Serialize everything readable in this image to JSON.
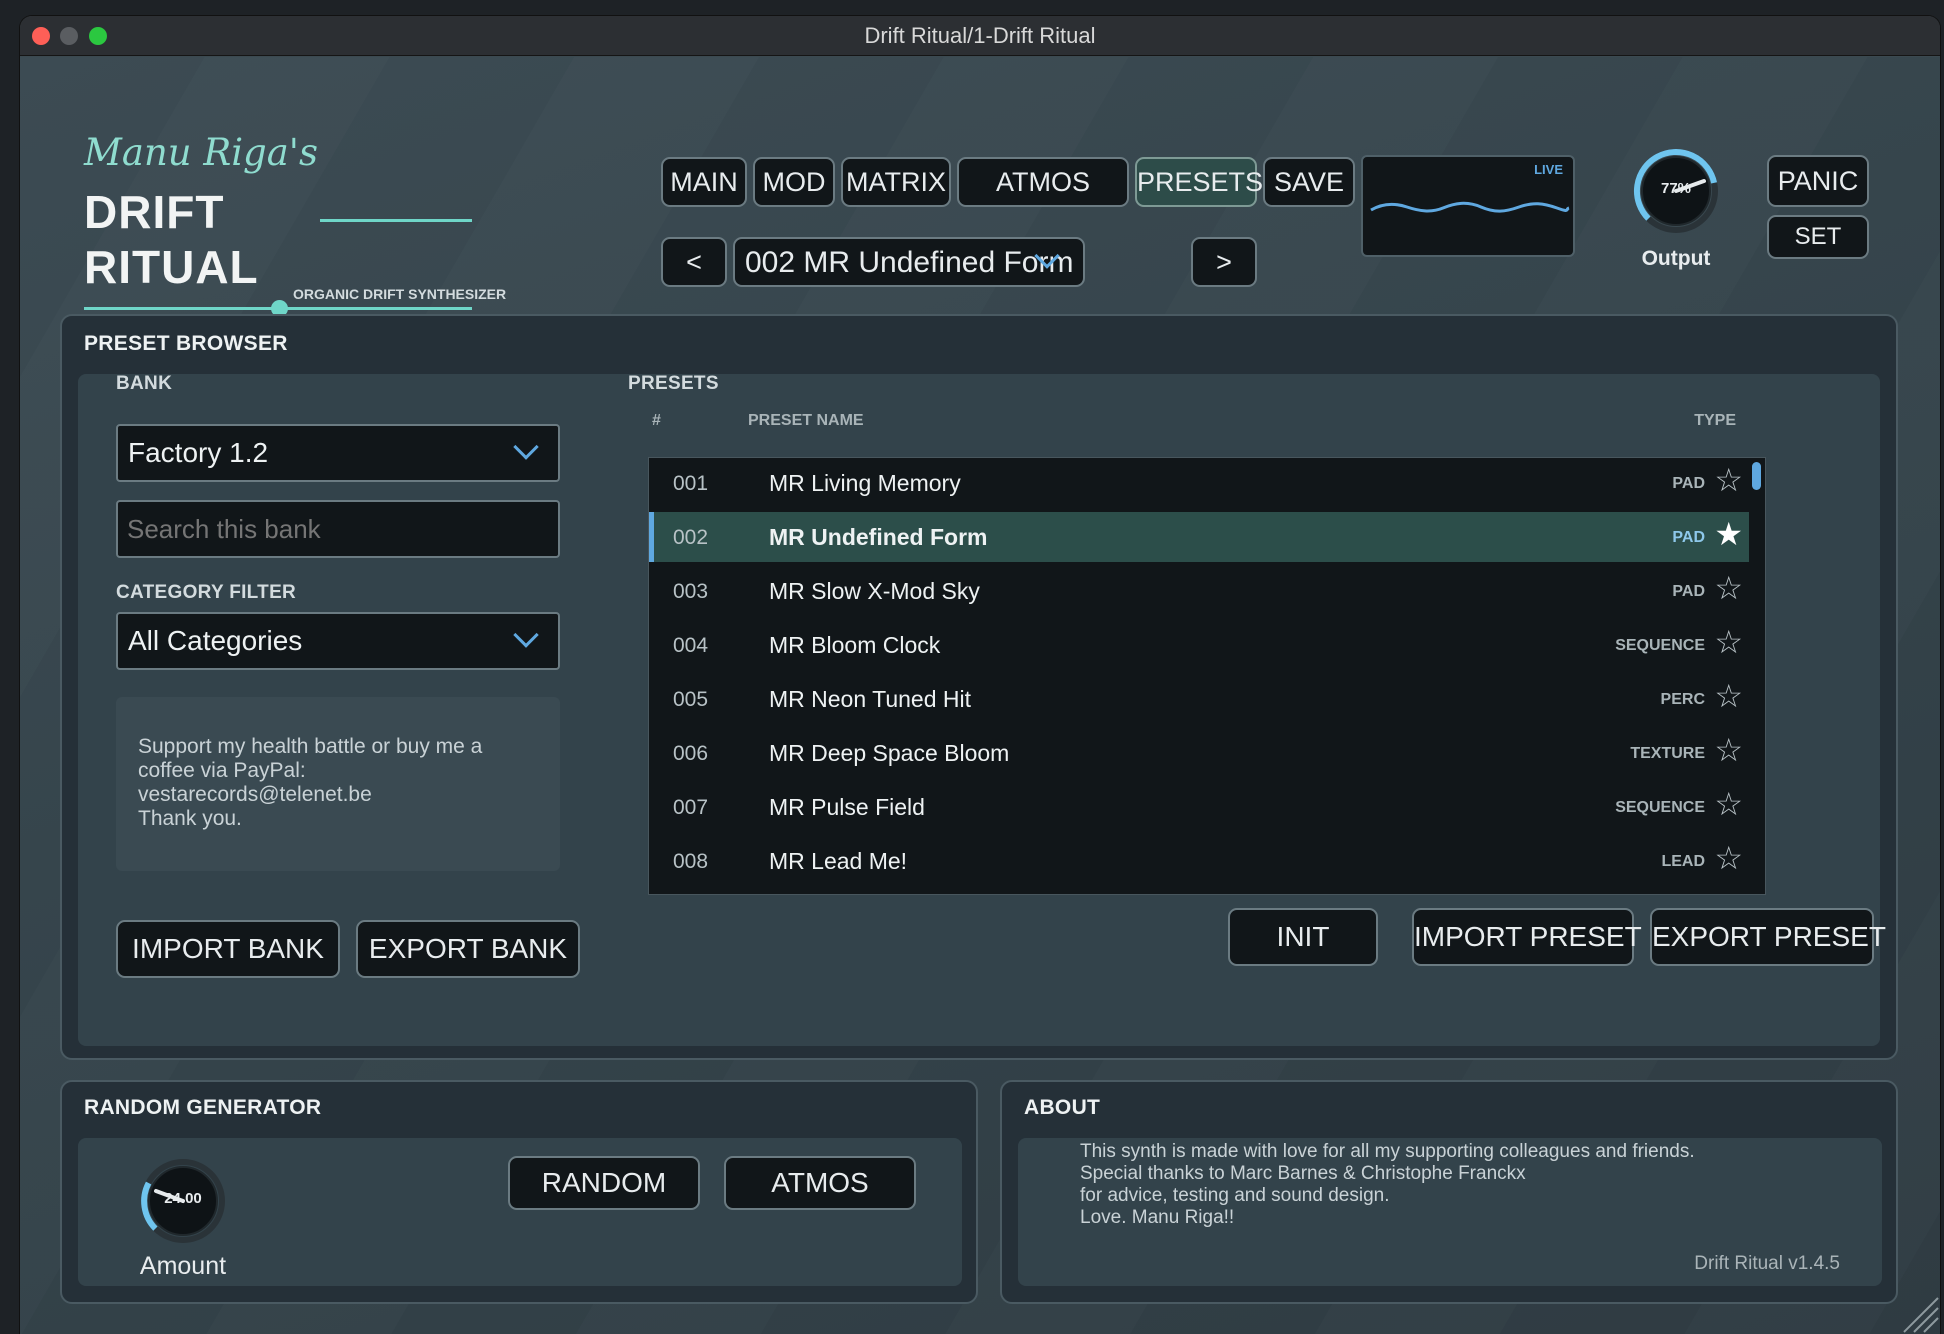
{
  "window": {
    "title": "Drift Ritual/1-Drift Ritual"
  },
  "brand": {
    "signature": "Manu Riga's",
    "name_line1": "DRIFT",
    "name_line2": "RITUAL",
    "tagline": "ORGANIC DRIFT SYNTHESIZER"
  },
  "nav": {
    "tabs": [
      {
        "label": "MAIN"
      },
      {
        "label": "MOD"
      },
      {
        "label": "MATRIX"
      },
      {
        "label": "ATMOS"
      },
      {
        "label": "PRESETS"
      },
      {
        "label": "SAVE"
      }
    ],
    "active_tab": "PRESETS"
  },
  "preset_selector": {
    "prev_label": "<",
    "next_label": ">",
    "current": "002 MR Undefined Form"
  },
  "scope": {
    "label": "LIVE"
  },
  "output": {
    "value_text": "77%",
    "value": 77,
    "label": "Output"
  },
  "actions": {
    "panic_label": "PANIC",
    "set_label": "SET"
  },
  "browser": {
    "title": "PRESET BROWSER",
    "bank_label": "BANK",
    "bank_value": "Factory 1.2",
    "search_placeholder": "Search this bank",
    "category_label": "CATEGORY FILTER",
    "category_value": "All Categories",
    "support_text": [
      "Support my health battle or buy me a",
      "coffee via PayPal:",
      "vestarecords@telenet.be",
      "Thank you."
    ],
    "import_bank_label": "IMPORT BANK",
    "export_bank_label": "EXPORT BANK",
    "presets_label": "PRESETS",
    "columns": {
      "num": "#",
      "name": "PRESET NAME",
      "type": "TYPE"
    },
    "presets": [
      {
        "num": "001",
        "name": "MR Living Memory",
        "type": "PAD",
        "selected": false
      },
      {
        "num": "002",
        "name": "MR Undefined Form",
        "type": "PAD",
        "selected": true
      },
      {
        "num": "003",
        "name": "MR Slow X-Mod Sky",
        "type": "PAD",
        "selected": false
      },
      {
        "num": "004",
        "name": "MR Bloom Clock",
        "type": "SEQUENCE",
        "selected": false
      },
      {
        "num": "005",
        "name": "MR Neon Tuned Hit",
        "type": "PERC",
        "selected": false
      },
      {
        "num": "006",
        "name": "MR Deep Space Bloom",
        "type": "TEXTURE",
        "selected": false
      },
      {
        "num": "007",
        "name": "MR Pulse Field",
        "type": "SEQUENCE",
        "selected": false
      },
      {
        "num": "008",
        "name": "MR Lead Me!",
        "type": "LEAD",
        "selected": false
      }
    ],
    "init_label": "INIT",
    "import_preset_label": "IMPORT PRESET",
    "export_preset_label": "EXPORT PRESET"
  },
  "random": {
    "title": "RANDOM GENERATOR",
    "amount_text": "24.00",
    "amount_label": "Amount",
    "random_label": "RANDOM",
    "atmos_label": "ATMOS"
  },
  "about": {
    "title": "ABOUT",
    "lines": [
      "This synth is made with love for all my supporting colleagues and friends.",
      "Special thanks to Marc Barnes & Christophe Franckx",
      "for advice, testing and sound design.",
      "Love. Manu Riga!!"
    ],
    "version": "Drift Ritual v1.4.5"
  },
  "colors": {
    "accent_teal": "#6fd6c8",
    "accent_blue": "#5fa8e0",
    "selected_row": "#2c4e4a"
  }
}
